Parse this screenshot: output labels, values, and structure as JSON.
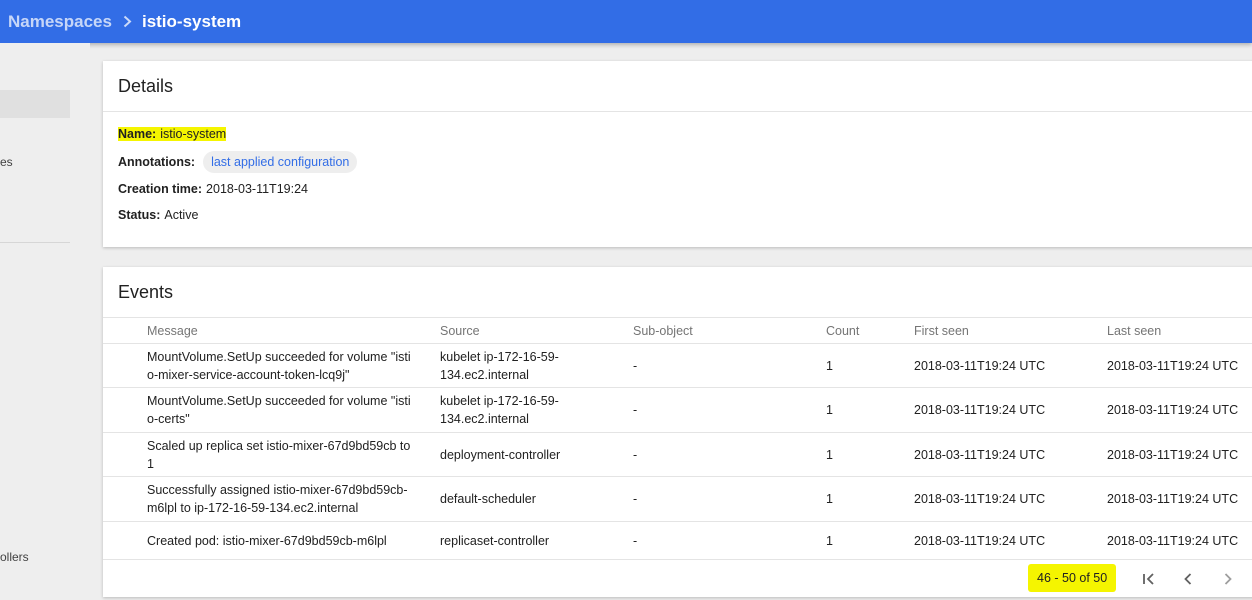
{
  "breadcrumb": {
    "parent": "Namespaces",
    "current": "istio-system"
  },
  "sidebar": {
    "items": [
      {
        "label": "es"
      },
      {
        "label": "ollers"
      }
    ]
  },
  "details": {
    "title": "Details",
    "name_label": "Name:",
    "name_value": "istio-system",
    "annotations_label": "Annotations:",
    "annotations_chip": "last applied configuration",
    "creation_label": "Creation time:",
    "creation_value": "2018-03-11T19:24",
    "status_label": "Status:",
    "status_value": "Active"
  },
  "events": {
    "title": "Events",
    "columns": [
      "Message",
      "Source",
      "Sub-object",
      "Count",
      "First seen",
      "Last seen"
    ],
    "rows": [
      {
        "message": [
          "MountVolume.SetUp succeeded for volume \"isti",
          "o-mixer-service-account-token-lcq9j\""
        ],
        "source": [
          "kubelet ip-172-16-59-",
          "134.ec2.internal"
        ],
        "subobject": "-",
        "count": "1",
        "first_seen": "2018-03-11T19:24 UTC",
        "last_seen": "2018-03-11T19:24 UTC"
      },
      {
        "message": [
          "MountVolume.SetUp succeeded for volume \"isti",
          "o-certs\""
        ],
        "source": [
          "kubelet ip-172-16-59-",
          "134.ec2.internal"
        ],
        "subobject": "-",
        "count": "1",
        "first_seen": "2018-03-11T19:24 UTC",
        "last_seen": "2018-03-11T19:24 UTC"
      },
      {
        "message": [
          "Scaled up replica set istio-mixer-67d9bd59cb to",
          "1"
        ],
        "source": [
          "deployment-controller"
        ],
        "subobject": "-",
        "count": "1",
        "first_seen": "2018-03-11T19:24 UTC",
        "last_seen": "2018-03-11T19:24 UTC"
      },
      {
        "message": [
          "Successfully assigned istio-mixer-67d9bd59cb-",
          "m6lpl to ip-172-16-59-134.ec2.internal"
        ],
        "source": [
          "default-scheduler"
        ],
        "subobject": "-",
        "count": "1",
        "first_seen": "2018-03-11T19:24 UTC",
        "last_seen": "2018-03-11T19:24 UTC"
      },
      {
        "message": [
          "Created pod: istio-mixer-67d9bd59cb-m6lpl"
        ],
        "source": [
          "replicaset-controller"
        ],
        "subobject": "-",
        "count": "1",
        "first_seen": "2018-03-11T19:24 UTC",
        "last_seen": "2018-03-11T19:24 UTC"
      }
    ],
    "pagination": {
      "range": "46 - 50 of 50"
    }
  },
  "icons": {
    "breadcrumb_separator": "chevron-right-icon",
    "first_page": "first-page-icon",
    "prev_page": "chevron-left-icon",
    "next_page": "chevron-right-icon"
  },
  "colors": {
    "toolbar": "#326de6",
    "highlight": "#f5f500",
    "chip_text": "#326de6"
  }
}
